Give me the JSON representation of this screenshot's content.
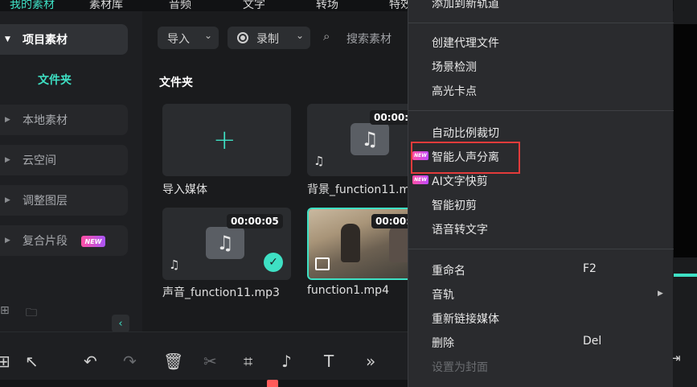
{
  "top_nav": {
    "tabs": [
      "我的素材",
      "素材库",
      "音频",
      "文字",
      "转场",
      "特效"
    ]
  },
  "sidebar": {
    "items": [
      {
        "label": "项目素材",
        "active": true
      },
      {
        "label": "本地素材"
      },
      {
        "label": "云空间"
      },
      {
        "label": "调整图层"
      },
      {
        "label": "复合片段",
        "badge": "NEW"
      }
    ],
    "folder_label": "文件夹"
  },
  "toolbar": {
    "import_label": "导入",
    "record_label": "录制",
    "search_placeholder": "搜索素材"
  },
  "section_title": "文件夹",
  "media": [
    {
      "name": "导入媒体"
    },
    {
      "name": "背景_function11.m",
      "duration": "00:00:0"
    },
    {
      "name": "声音_function11.mp3",
      "duration": "00:00:05"
    },
    {
      "name": "function1.mp4",
      "duration": "00:00:0"
    }
  ],
  "context_menu": {
    "items": [
      {
        "label": "添加到新轨道"
      },
      {
        "label": "创建代理文件"
      },
      {
        "label": "场景检测"
      },
      {
        "label": "高光卡点"
      },
      {
        "label": "自动比例裁切"
      },
      {
        "label": "智能人声分离",
        "badge": "NEW",
        "highlighted": true
      },
      {
        "label": "AI文字快剪",
        "badge": "NEW"
      },
      {
        "label": "智能初剪"
      },
      {
        "label": "语音转文字"
      },
      {
        "label": "重命名",
        "shortcut": "F2"
      },
      {
        "label": "音轨",
        "submenu": true
      },
      {
        "label": "重新链接媒体"
      },
      {
        "label": "删除",
        "shortcut": "Del"
      },
      {
        "label": "设置为封面",
        "disabled": true
      }
    ]
  },
  "colors": {
    "accent": "#3ee0c4",
    "highlight_box": "#e23b3b",
    "badge_gradient_start": "#ff4fa3",
    "badge_gradient_end": "#a855f7"
  }
}
